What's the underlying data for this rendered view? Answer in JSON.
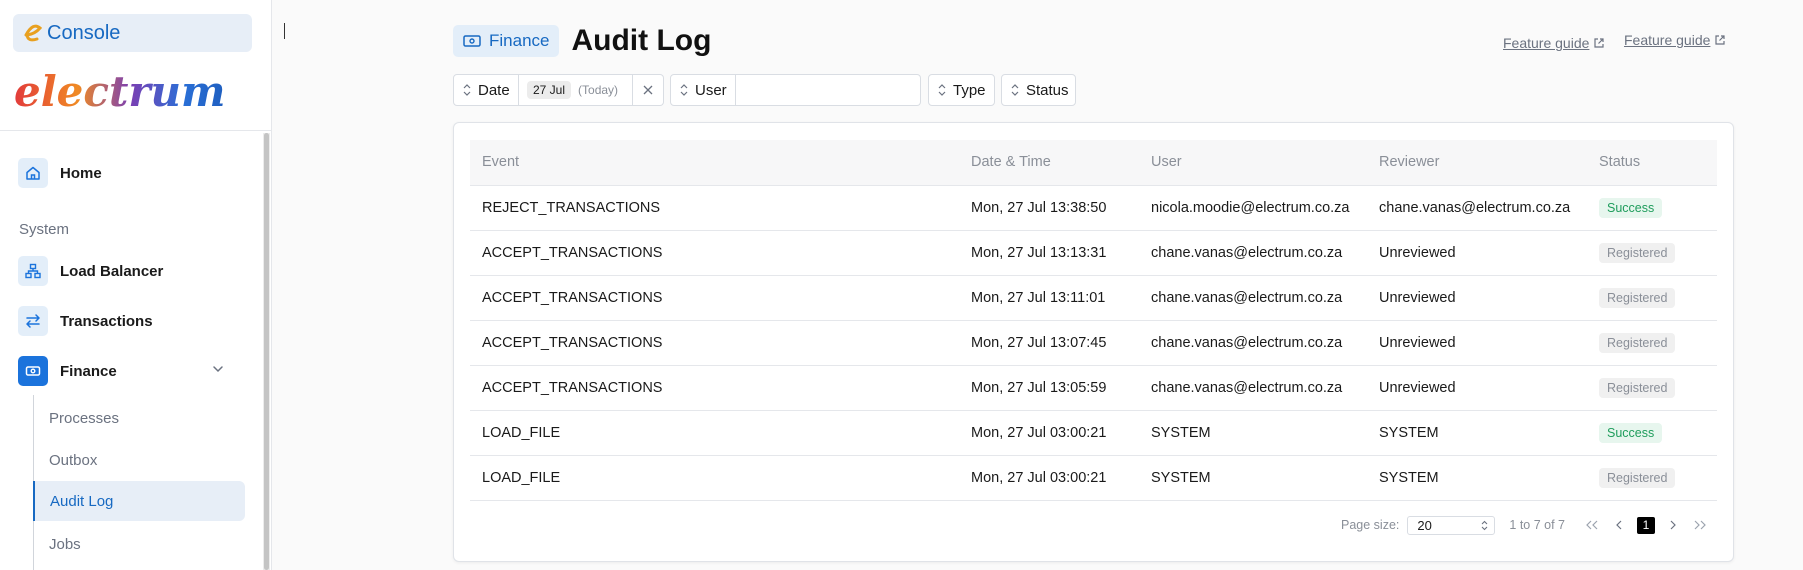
{
  "sidebar": {
    "console_label": "Console",
    "brand": "electrum",
    "items": [
      {
        "label": "Home"
      },
      {
        "label": "Load Balancer"
      },
      {
        "label": "Transactions"
      },
      {
        "label": "Finance"
      }
    ],
    "section_system": "System",
    "finance_subitems": [
      {
        "label": "Processes"
      },
      {
        "label": "Outbox"
      },
      {
        "label": "Audit Log"
      },
      {
        "label": "Jobs"
      }
    ]
  },
  "header": {
    "badge_label": "Finance",
    "title": "Audit Log",
    "guide_link": "Feature guide"
  },
  "filters": {
    "date_label": "Date",
    "date_value": "27 Jul",
    "date_hint": "(Today)",
    "user_label": "User",
    "user_value": "",
    "type_label": "Type",
    "status_label": "Status"
  },
  "table": {
    "columns": [
      "Event",
      "Date & Time",
      "User",
      "Reviewer",
      "Status"
    ],
    "rows": [
      {
        "event": "REJECT_TRANSACTIONS",
        "datetime": "Mon, 27 Jul 13:38:50",
        "user": "nicola.moodie@electrum.co.za",
        "reviewer": "chane.vanas@electrum.co.za",
        "status": "Success"
      },
      {
        "event": "ACCEPT_TRANSACTIONS",
        "datetime": "Mon, 27 Jul 13:13:31",
        "user": "chane.vanas@electrum.co.za",
        "reviewer": "Unreviewed",
        "status": "Registered"
      },
      {
        "event": "ACCEPT_TRANSACTIONS",
        "datetime": "Mon, 27 Jul 13:11:01",
        "user": "chane.vanas@electrum.co.za",
        "reviewer": "Unreviewed",
        "status": "Registered"
      },
      {
        "event": "ACCEPT_TRANSACTIONS",
        "datetime": "Mon, 27 Jul 13:07:45",
        "user": "chane.vanas@electrum.co.za",
        "reviewer": "Unreviewed",
        "status": "Registered"
      },
      {
        "event": "ACCEPT_TRANSACTIONS",
        "datetime": "Mon, 27 Jul 13:05:59",
        "user": "chane.vanas@electrum.co.za",
        "reviewer": "Unreviewed",
        "status": "Registered"
      },
      {
        "event": "LOAD_FILE",
        "datetime": "Mon, 27 Jul 03:00:21",
        "user": "SYSTEM",
        "reviewer": "SYSTEM",
        "status": "Success"
      },
      {
        "event": "LOAD_FILE",
        "datetime": "Mon, 27 Jul 03:00:21",
        "user": "SYSTEM",
        "reviewer": "SYSTEM",
        "status": "Registered"
      }
    ]
  },
  "pagination": {
    "page_size_label": "Page size:",
    "page_size": "20",
    "range": "1 to 7 of 7",
    "current_page": "1"
  },
  "colors": {
    "accent": "#1769c2",
    "success_bg": "#e7f6ee",
    "success_text": "#1f9d5c",
    "registered_bg": "#f0f0f0",
    "registered_text": "#8a8f98"
  }
}
